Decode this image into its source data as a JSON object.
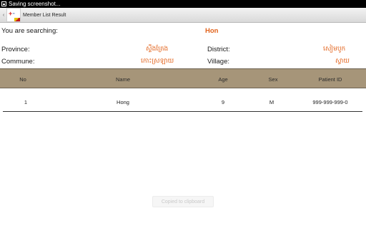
{
  "status_bar": {
    "notification_text": "Saving screenshot..."
  },
  "action_bar": {
    "title": "Member List Result"
  },
  "search": {
    "label": "You are searching:",
    "value": "Hon"
  },
  "location": {
    "province_label": "Province:",
    "province_value": "ស្ទឹងត្រែង",
    "district_label": "District:",
    "district_value": "សៀមបូក",
    "commune_label": "Commune:",
    "commune_value": "កោះស្រឡាយ",
    "village_label": "Village:",
    "village_value": "ស្វាយ"
  },
  "table": {
    "headers": {
      "no": "No",
      "name": "Name",
      "age": "Age",
      "sex": "Sex",
      "patient_id": "Patient ID"
    },
    "rows": [
      {
        "no": "1",
        "name": "Hong",
        "age": "9",
        "sex": "M",
        "patient_id": "999-999-999-0"
      }
    ]
  },
  "toast": {
    "text": "Copied to clipboard"
  },
  "colors": {
    "accent": "#e2631c",
    "table_header": "#a69579"
  }
}
